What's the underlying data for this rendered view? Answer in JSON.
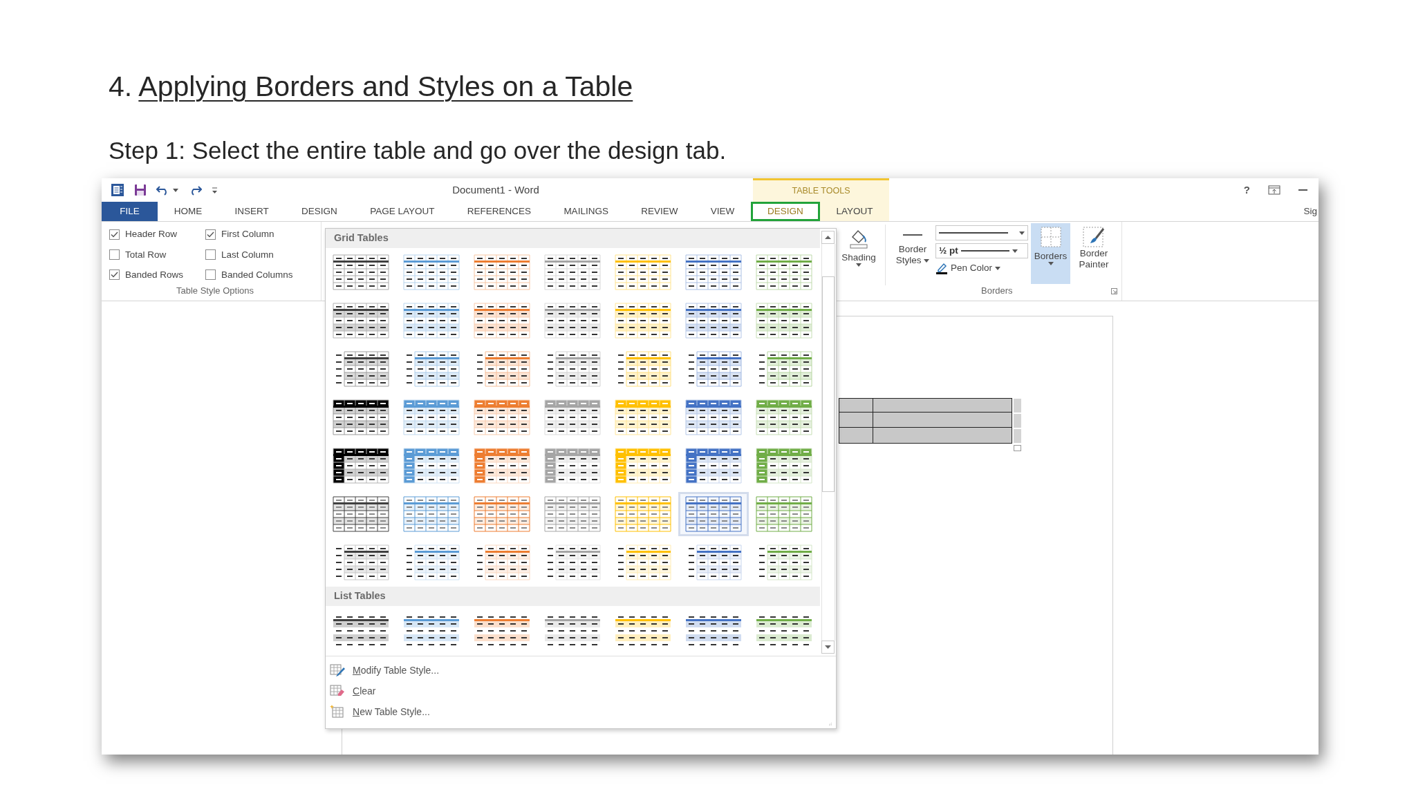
{
  "slide": {
    "number": "4.",
    "title": "Applying Borders and Styles on a Table",
    "step": "Step 1: Select the entire table and go over the design tab."
  },
  "window": {
    "title": "Document1 - Word",
    "contextual_header": "TABLE TOOLS",
    "help": "?",
    "account": "Sig"
  },
  "tabs": [
    {
      "label": "FILE",
      "kind": "file",
      "selected": false
    },
    {
      "label": "HOME",
      "kind": "tab",
      "selected": false
    },
    {
      "label": "INSERT",
      "kind": "tab",
      "selected": false
    },
    {
      "label": "DESIGN",
      "kind": "tab",
      "selected": false
    },
    {
      "label": "PAGE LAYOUT",
      "kind": "tab",
      "selected": false
    },
    {
      "label": "REFERENCES",
      "kind": "tab",
      "selected": false
    },
    {
      "label": "MAILINGS",
      "kind": "tab",
      "selected": false
    },
    {
      "label": "REVIEW",
      "kind": "tab",
      "selected": false
    },
    {
      "label": "VIEW",
      "kind": "tab",
      "selected": false
    },
    {
      "label": "DESIGN",
      "kind": "contextual",
      "selected": true
    },
    {
      "label": "LAYOUT",
      "kind": "contextual",
      "selected": false
    }
  ],
  "table_style_options": {
    "label": "Table Style Options",
    "options": [
      {
        "label": "Header Row",
        "checked": true
      },
      {
        "label": "First Column",
        "checked": true
      },
      {
        "label": "Total Row",
        "checked": false
      },
      {
        "label": "Last Column",
        "checked": false
      },
      {
        "label": "Banded Rows",
        "checked": true
      },
      {
        "label": "Banded Columns",
        "checked": false
      }
    ]
  },
  "gallery": {
    "grid_header": "Grid Tables",
    "grid_rows": [
      {
        "kind": "grid",
        "items": [
          {
            "color": "#404040",
            "selected": false
          },
          {
            "color": "#5b9bd5",
            "selected": false
          },
          {
            "color": "#ed7d31",
            "selected": false
          },
          {
            "color": "#a5a5a5",
            "selected": false
          },
          {
            "color": "#ffc000",
            "selected": false
          },
          {
            "color": "#4472c4",
            "selected": false
          },
          {
            "color": "#70ad47",
            "selected": false
          }
        ]
      },
      {
        "kind": "bands",
        "items": [
          {
            "color": "#404040",
            "selected": false
          },
          {
            "color": "#5b9bd5",
            "selected": false
          },
          {
            "color": "#ed7d31",
            "selected": false
          },
          {
            "color": "#a5a5a5",
            "selected": false
          },
          {
            "color": "#ffc000",
            "selected": false
          },
          {
            "color": "#4472c4",
            "selected": false
          },
          {
            "color": "#70ad47",
            "selected": false
          }
        ]
      },
      {
        "kind": "side",
        "items": [
          {
            "color": "#404040",
            "selected": false
          },
          {
            "color": "#5b9bd5",
            "selected": false
          },
          {
            "color": "#ed7d31",
            "selected": false
          },
          {
            "color": "#a5a5a5",
            "selected": false
          },
          {
            "color": "#ffc000",
            "selected": false
          },
          {
            "color": "#4472c4",
            "selected": false
          },
          {
            "color": "#70ad47",
            "selected": false
          }
        ]
      },
      {
        "kind": "header",
        "items": [
          {
            "color": "#000000",
            "selected": false
          },
          {
            "color": "#5b9bd5",
            "selected": false
          },
          {
            "color": "#ed7d31",
            "selected": false
          },
          {
            "color": "#a5a5a5",
            "selected": false
          },
          {
            "color": "#ffc000",
            "selected": false
          },
          {
            "color": "#4472c4",
            "selected": false
          },
          {
            "color": "#70ad47",
            "selected": false
          }
        ]
      },
      {
        "kind": "accent",
        "items": [
          {
            "color": "#000000",
            "selected": false
          },
          {
            "color": "#5b9bd5",
            "selected": false
          },
          {
            "color": "#ed7d31",
            "selected": false
          },
          {
            "color": "#a5a5a5",
            "selected": false
          },
          {
            "color": "#ffc000",
            "selected": false
          },
          {
            "color": "#4472c4",
            "selected": false
          },
          {
            "color": "#70ad47",
            "selected": false
          }
        ]
      },
      {
        "kind": "lined",
        "items": [
          {
            "color": "#404040",
            "selected": false
          },
          {
            "color": "#5b9bd5",
            "selected": false
          },
          {
            "color": "#ed7d31",
            "selected": false
          },
          {
            "color": "#a5a5a5",
            "selected": false
          },
          {
            "color": "#ffc000",
            "selected": false
          },
          {
            "color": "#4472c4",
            "selected": true
          },
          {
            "color": "#70ad47",
            "selected": false
          }
        ]
      },
      {
        "kind": "faint",
        "items": [
          {
            "color": "#404040",
            "selected": false
          },
          {
            "color": "#5b9bd5",
            "selected": false
          },
          {
            "color": "#ed7d31",
            "selected": false
          },
          {
            "color": "#a5a5a5",
            "selected": false
          },
          {
            "color": "#ffc000",
            "selected": false
          },
          {
            "color": "#4472c4",
            "selected": false
          },
          {
            "color": "#70ad47",
            "selected": false
          }
        ]
      }
    ],
    "list_header": "List Tables",
    "list_rows": [
      {
        "kind": "list",
        "items": [
          {
            "color": "#404040",
            "selected": false
          },
          {
            "color": "#5b9bd5",
            "selected": false
          },
          {
            "color": "#ed7d31",
            "selected": false
          },
          {
            "color": "#a5a5a5",
            "selected": false
          },
          {
            "color": "#ffc000",
            "selected": false
          },
          {
            "color": "#4472c4",
            "selected": false
          },
          {
            "color": "#70ad47",
            "selected": false
          }
        ]
      }
    ],
    "menu": [
      {
        "label": "Modify Table Style...",
        "kind": "modify"
      },
      {
        "label": "Clear",
        "kind": "clear"
      },
      {
        "label": "New Table Style...",
        "kind": "new"
      }
    ]
  },
  "shading": {
    "label": "Shading"
  },
  "borders_group": {
    "label": "Borders",
    "border_styles": "Border Styles",
    "weight": "½ pt",
    "pen_color": "Pen Color",
    "borders": {
      "label": "Borders",
      "highlighted": true
    },
    "border_painter": "Border Painter"
  },
  "document_table": {
    "selected": true
  }
}
